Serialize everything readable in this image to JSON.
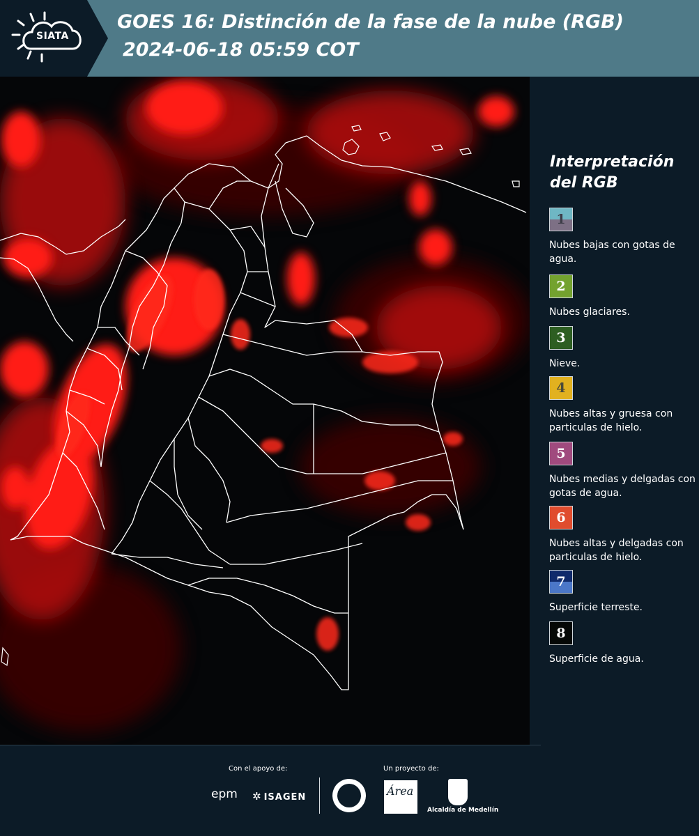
{
  "header": {
    "logo_text": "SIATA",
    "title_line1": "GOES 16: Distinción de la fase de la nube (RGB)",
    "title_line2": "2024-06-18 05:59 COT"
  },
  "legend": {
    "title": "Interpretación del RGB",
    "items": [
      {
        "number": "1",
        "label": "Nubes bajas con gotas de agua.",
        "color_top": "#6fb7c4",
        "color_bottom": "#7d7085",
        "text_color": "#3d3d48"
      },
      {
        "number": "2",
        "label": "Nubes glaciares.",
        "color_top": "#73a22f",
        "color_bottom": "#73a22f",
        "text_color": "#ffffff"
      },
      {
        "number": "3",
        "label": "Nieve.",
        "color_top": "#2d5e22",
        "color_bottom": "#2d5e22",
        "text_color": "#ffffff"
      },
      {
        "number": "4",
        "label": "Nubes altas y gruesa con particulas de hielo.",
        "color_top": "#e2b11f",
        "color_bottom": "#e2b11f",
        "text_color": "#4a4a3a"
      },
      {
        "number": "5",
        "label": "Nubes medias y delgadas con gotas de agua.",
        "color_top": "#a04a7e",
        "color_bottom": "#a04a7e",
        "text_color": "#ffffff"
      },
      {
        "number": "6",
        "label": "Nubes altas y delgadas con particulas de hielo.",
        "color_top": "#e04c2e",
        "color_bottom": "#e04c2e",
        "text_color": "#ffffff"
      },
      {
        "number": "7",
        "label": "Superficie terreste.",
        "color_top": "#102a6b",
        "color_bottom": "#4b77c8",
        "text_color": "#ffffff"
      },
      {
        "number": "8",
        "label": "Superficie de agua.",
        "color_top": "#050806",
        "color_bottom": "#050806",
        "text_color": "#ffffff"
      }
    ]
  },
  "footer": {
    "support_label": "Con el apoyo de:",
    "project_label": "Un proyecto de:",
    "epm_text": "epm",
    "isagen_text": "ISAGEN",
    "area_text": "Área",
    "alcaldia_text": "Alcaldía de Medellín"
  },
  "colors": {
    "header_bg": "#4f7a88",
    "panel_bg": "#0c1b27",
    "cloud_red": "#ff1a12",
    "border_white": "#ffffff"
  }
}
